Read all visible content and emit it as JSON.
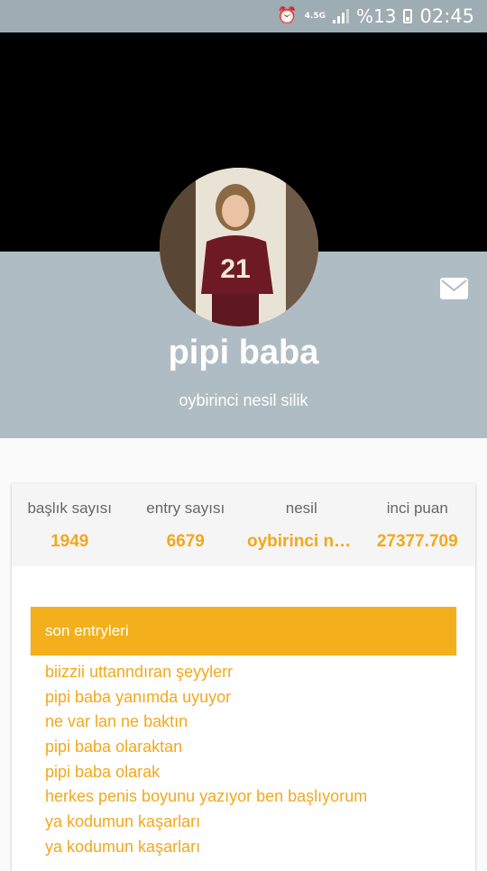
{
  "status_bar": {
    "network": "4.5G",
    "battery_percent": "%13",
    "time": "02:45"
  },
  "profile": {
    "username": "pipi baba",
    "subtitle": "oybirinci nesil silik",
    "avatar_jersey_number": "21"
  },
  "stats": [
    {
      "label": "başlık sayısı",
      "value": "1949"
    },
    {
      "label": "entry sayısı",
      "value": "6679"
    },
    {
      "label": "nesil",
      "value": "oybirinci nesil silik"
    },
    {
      "label": "inci puan",
      "value": "27377.709"
    }
  ],
  "recent_entries": {
    "title": "son entryleri",
    "items": [
      "biizzii uttanndıran şeyylerr",
      "pipi baba yanımda uyuyor",
      "ne var lan ne baktın",
      "pipi baba olaraktan",
      "pipi baba olarak",
      "herkes penis boyunu yazıyor ben başlıyorum",
      "ya kodumun kaşarları",
      "ya kodumun kaşarları"
    ]
  },
  "colors": {
    "accent": "#f3b01c",
    "band": "#afbcc3",
    "statusbar": "#9eacb4"
  },
  "icons": [
    "alarm-icon",
    "signal-icon",
    "battery-charging-icon",
    "mail-icon"
  ]
}
